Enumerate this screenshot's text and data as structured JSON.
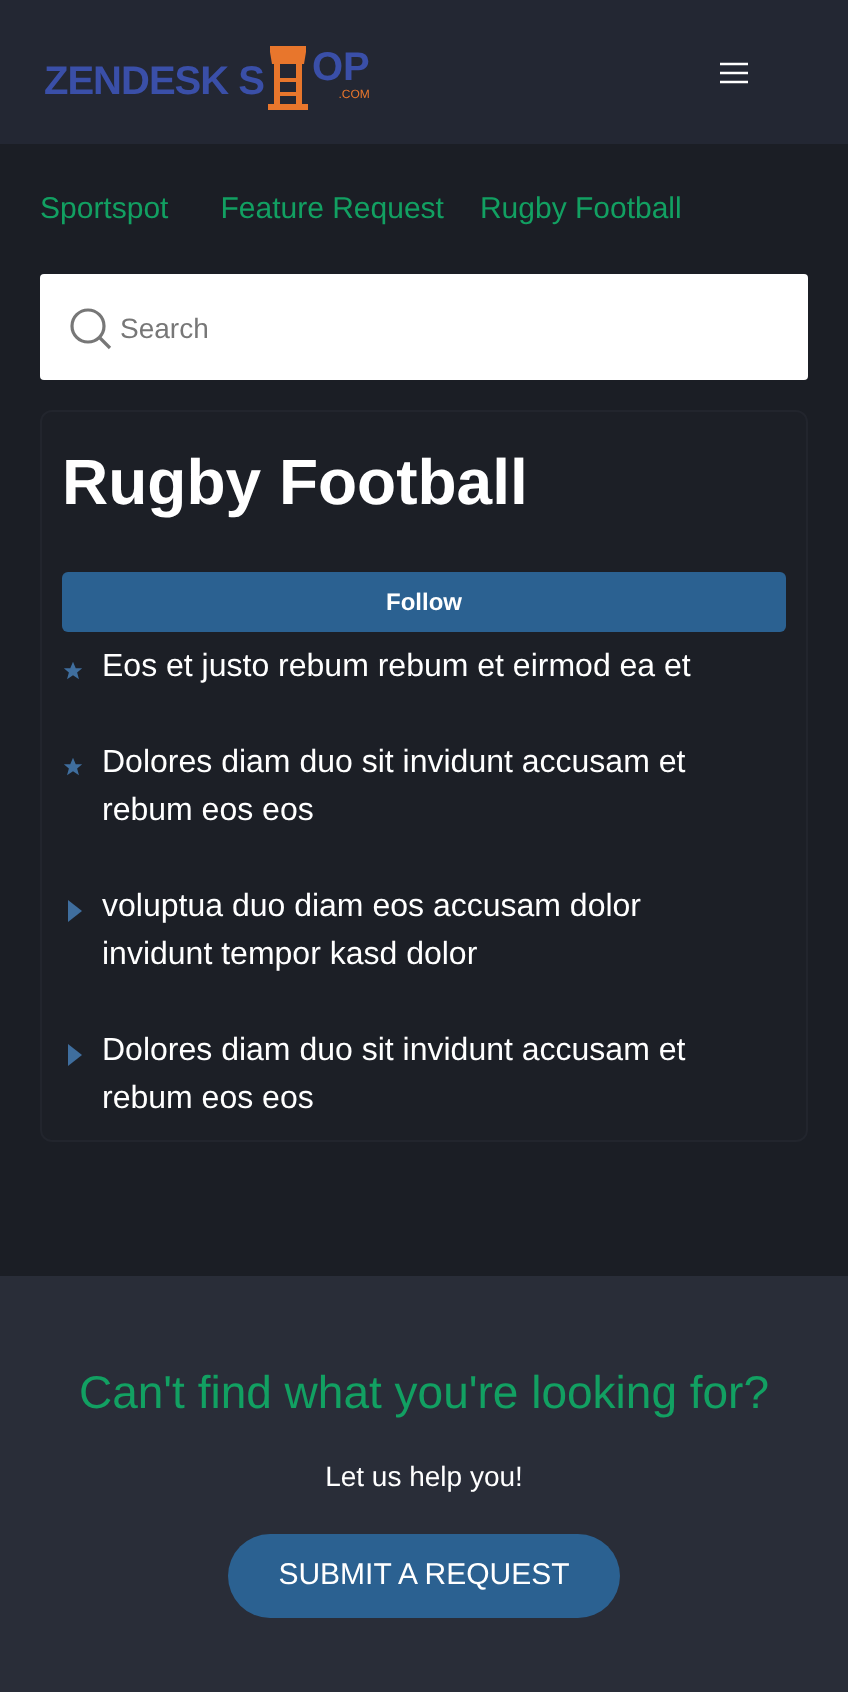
{
  "header": {
    "logo": {
      "text_before": "ZENDESK S",
      "text_after": "OP",
      "suffix": ".COM"
    }
  },
  "breadcrumbs": [
    "Sportspot",
    "Feature Request",
    "Rugby Football"
  ],
  "search": {
    "placeholder": "Search"
  },
  "section": {
    "title": "Rugby Football",
    "follow_button": "Follow",
    "articles": [
      {
        "kind": "promoted",
        "title": "Eos et justo rebum rebum et eirmod ea et"
      },
      {
        "kind": "promoted",
        "title": "Dolores diam duo sit invidunt accusam et rebum eos eos"
      },
      {
        "kind": "normal",
        "title": "voluptua duo diam eos accusam dolor invidunt tempor kasd dolor"
      },
      {
        "kind": "normal",
        "title": "Dolores diam duo sit invidunt accusam et rebum eos eos"
      }
    ]
  },
  "footer": {
    "heading": "Can't find what you're looking for?",
    "subtext": "Let us help you!",
    "button": "SUBMIT A REQUEST"
  }
}
